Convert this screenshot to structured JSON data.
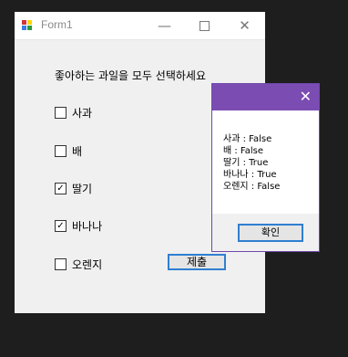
{
  "window": {
    "title": "Form1",
    "min_glyph": "—",
    "close_glyph": "✕"
  },
  "form": {
    "prompt": "좋아하는 과일을 모두 선택하세요",
    "checkboxes": [
      {
        "label": "사과",
        "checked": false
      },
      {
        "label": "배",
        "checked": false
      },
      {
        "label": "딸기",
        "checked": true
      },
      {
        "label": "바나나",
        "checked": true
      },
      {
        "label": "오렌지",
        "checked": false
      }
    ],
    "submit_label": "제출"
  },
  "dialog": {
    "close_glyph": "✕",
    "lines": [
      "사과 : False",
      "배 : False",
      "딸기 : True",
      "바나나 : True",
      "오렌지 : False"
    ],
    "ok_label": "확인"
  },
  "colors": {
    "dialog_title": "#7b4db3",
    "button_border": "#2f7fd1"
  }
}
